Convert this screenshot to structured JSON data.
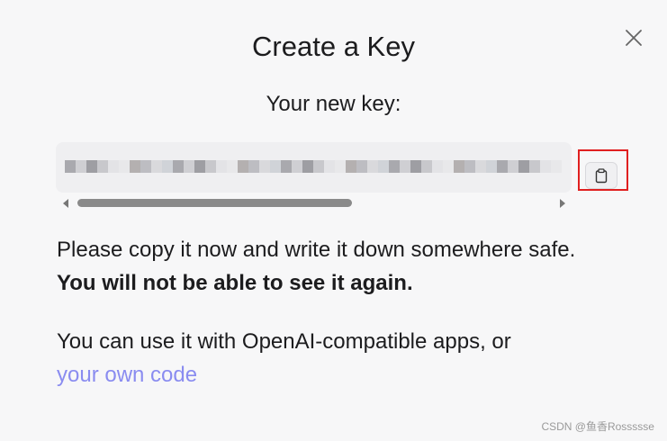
{
  "dialog": {
    "title": "Create a Key",
    "subtitle": "Your new key:",
    "close_icon": "close-icon",
    "copy_icon": "clipboard-icon",
    "key_value_obscured": true,
    "paragraph1_text": "Please copy it now and write it down somewhere safe.",
    "paragraph1_bold": "You will not be able to see it again.",
    "paragraph2_text": "You can use it with OpenAI-compatible apps, or",
    "paragraph2_link": "your own code"
  },
  "watermark": "CSDN @鱼香Rossssse",
  "colors": {
    "accent_link": "#8a8cf0",
    "highlight_border": "#e02020",
    "background": "#f7f7f8"
  }
}
